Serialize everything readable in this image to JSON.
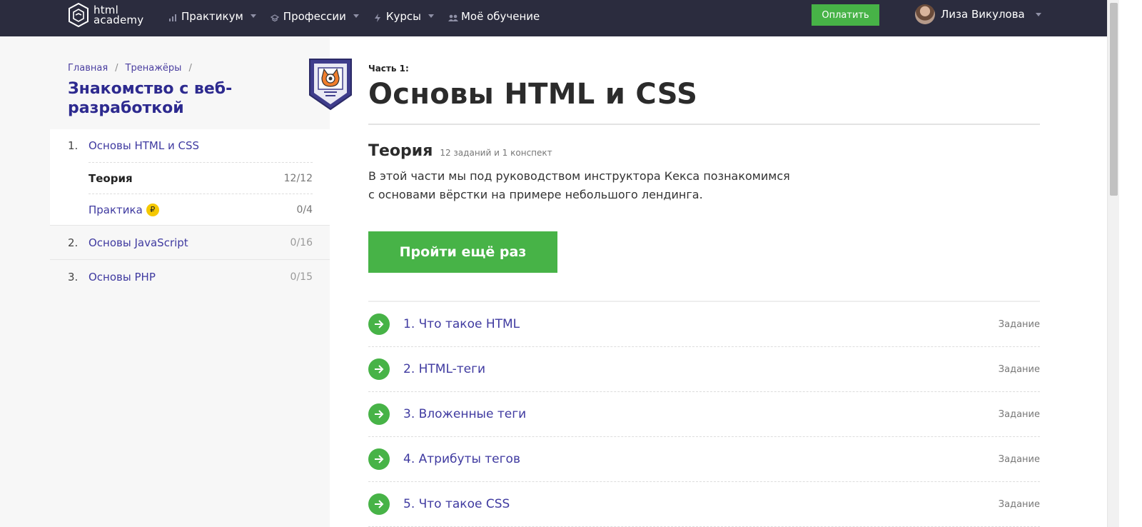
{
  "header": {
    "logo": {
      "line1": "html",
      "line2": "academy"
    },
    "nav": [
      {
        "label": "Практикум",
        "icon": "bar-chart-icon",
        "has_caret": true
      },
      {
        "label": "Профессии",
        "icon": "graduation-cap-icon",
        "has_caret": true
      },
      {
        "label": "Курсы",
        "icon": "lightning-icon",
        "has_caret": true
      },
      {
        "label": "Моё обучение",
        "icon": "people-icon",
        "has_caret": false
      }
    ],
    "pay_label": "Оплатить",
    "user_name": "Лиза Викулова"
  },
  "sidebar": {
    "breadcrumbs": [
      "Главная",
      "Тренажёры"
    ],
    "title": "Знакомство с веб-разработкой",
    "parts": [
      {
        "num": "1.",
        "label": "Основы HTML и CSS",
        "count": "",
        "subs": [
          {
            "label": "Теория",
            "count": "12/12",
            "current": true
          },
          {
            "label": "Практика",
            "count": "0/4",
            "current": false,
            "rub": "₽"
          }
        ]
      },
      {
        "num": "2.",
        "label": "Основы JavaScript",
        "count": "0/16"
      },
      {
        "num": "3.",
        "label": "Основы PHP",
        "count": "0/15"
      }
    ]
  },
  "main": {
    "part_label": "Часть 1:",
    "title": "Основы HTML и CSS",
    "theory_title": "Теория",
    "theory_meta": "12 заданий и 1 конспект",
    "description": "В этой части мы под руководством инструктора Кекса познакомимся с основами вёрстки на примере небольшого лендинга.",
    "retry_label": "Пройти ещё раз",
    "tasks": [
      {
        "label": "1. Что такое HTML",
        "type": "Задание"
      },
      {
        "label": "2. HTML-теги",
        "type": "Задание"
      },
      {
        "label": "3. Вложенные теги",
        "type": "Задание"
      },
      {
        "label": "4. Атрибуты тегов",
        "type": "Задание"
      },
      {
        "label": "5. Что такое CSS",
        "type": "Задание"
      }
    ]
  },
  "colors": {
    "header_bg": "#2b2c3e",
    "accent_green": "#47b347",
    "link_purple": "#3f3aa0",
    "title_purple": "#2d2a8f",
    "sidebar_bg": "#f7f7f7"
  }
}
